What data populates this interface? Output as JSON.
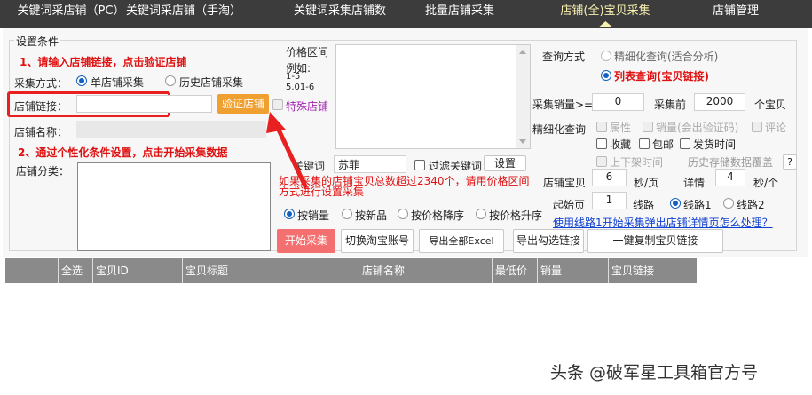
{
  "nav": {
    "tabs": [
      {
        "label": "关键词采店铺（PC）"
      },
      {
        "label": "关键词采店铺（手淘）"
      },
      {
        "label": "关键词采集店铺数"
      },
      {
        "label": "批量店铺采集"
      },
      {
        "label": "店铺(全)宝贝采集",
        "active": true
      },
      {
        "label": "店铺管理"
      }
    ]
  },
  "settings": {
    "title": "设置条件",
    "step1": "1、请输入店铺链接，点击验证店铺",
    "collect_mode_label": "采集方式：",
    "mode_single": "单店铺采集",
    "mode_history": "历史店铺采集",
    "shop_link_label": "店铺链接：",
    "shop_link_value": "",
    "verify_button": "验证店铺",
    "special_shop": "特殊店铺",
    "shop_name_label": "店铺名称：",
    "step2": "2、通过个性化条件设置，点击开始采集数据",
    "shop_category_label": "店铺分类：",
    "price_range_label": "价格区间",
    "example_label": "例如:",
    "example_1": "1-5",
    "example_2": "5.01-6",
    "keyword_label": "关键词",
    "keyword_value": "苏菲",
    "filter_keyword": "过滤关键词",
    "settings_button": "设置",
    "note_line1": "如果采集的店铺宝贝总数超过2340个，请用价格区间",
    "note_line2": "方式进行设置采集",
    "sort": {
      "by_sales": "按销量",
      "by_new": "按新品",
      "by_price_desc": "按价格降序",
      "by_price_asc": "按价格升序",
      "selected": "按销量"
    },
    "query_mode_label": "查询方式",
    "query_fine": "精细化查询(适合分析)",
    "query_list": "列表查询(宝贝链接)",
    "min_sales_label": "采集销量>=",
    "min_sales_value": "0",
    "collect_top_label": "采集前",
    "collect_top_value": "2000",
    "items_unit": "个宝贝",
    "fine_query_label": "精细化查询",
    "opt_attr": "属性",
    "opt_sales": "销量(会出验证码)",
    "opt_review": "评论",
    "opt_fav": "收藏",
    "opt_freeship": "包邮",
    "opt_ship_time": "发货时间",
    "opt_listing_time": "上下架时间",
    "history_overwrite": "历史存储数据覆盖",
    "help": "?",
    "shop_items_label": "店铺宝贝",
    "shop_items_value": "6",
    "sec_per_page": "秒/页",
    "detail_label": "详情",
    "detail_value": "4",
    "sec_per_item": "秒/个",
    "start_page_label": "起始页",
    "start_page_value": "1",
    "route_label": "线路",
    "route1": "线路1",
    "route2": "线路2",
    "route_help_link": "使用线路1开始采集弹出店铺详情页怎么处理？"
  },
  "actions": {
    "start": "开始采集",
    "switch_account": "切换淘宝账号",
    "export_all": "导出全部Excel",
    "export_selected": "导出勾选链接",
    "copy_links": "一键复制宝贝链接"
  },
  "table": {
    "columns": [
      "",
      "全选",
      "宝贝ID",
      "宝贝标题",
      "店铺名称",
      "最低价",
      "销量",
      "宝贝链接"
    ]
  },
  "watermark": "头条 @破军星工具箱官方号",
  "colors": {
    "nav_bg": "#3c3c3c",
    "accent_orange": "#f0a030",
    "start_red": "#f47070",
    "header_grey": "#8a8a8a"
  }
}
